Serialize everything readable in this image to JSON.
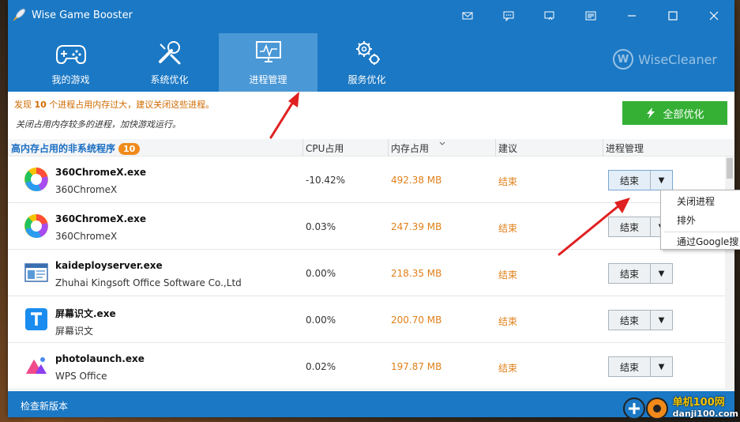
{
  "app": {
    "title": "Wise Game Booster"
  },
  "window_controls": [
    "mail-icon",
    "feedback-icon",
    "restore-icon",
    "menu-icon",
    "minimize-icon",
    "maximize-icon",
    "close-icon"
  ],
  "nav": {
    "tabs": [
      {
        "label": "我的游戏",
        "icon": "gamepad-icon",
        "active": false
      },
      {
        "label": "系统优化",
        "icon": "tools-icon",
        "active": false
      },
      {
        "label": "进程管理",
        "icon": "monitor-icon",
        "active": true
      },
      {
        "label": "服务优化",
        "icon": "gears-icon",
        "active": false
      }
    ]
  },
  "brand": {
    "name": "WiseCleaner",
    "letter": "W"
  },
  "notice": {
    "prefix": "发现 ",
    "count": "10",
    "suffix": " 个进程占用内存过大，建议关闭这些进程。",
    "sub": "关闭占用内存较多的进程，加快游戏运行。"
  },
  "optimize_button": "全部优化",
  "table": {
    "headers": {
      "name": "高内存占用的非系统程序",
      "badge": "10",
      "cpu": "CPU占用",
      "mem": "内存占用",
      "advice": "建议",
      "manage": "进程管理"
    },
    "rows": [
      {
        "name": "360ChromeX.exe",
        "desc": "360ChromeX",
        "cpu": "-10.42%",
        "mem": "492.38 MB",
        "advice": "结束",
        "action": "结束",
        "icon": "chrome-360-icon"
      },
      {
        "name": "360ChromeX.exe",
        "desc": "360ChromeX",
        "cpu": "0.03%",
        "mem": "247.39 MB",
        "advice": "结束",
        "action": "结束",
        "icon": "chrome-360-icon"
      },
      {
        "name": "kaideployserver.exe",
        "desc": "Zhuhai Kingsoft Office Software Co.,Ltd",
        "cpu": "0.00%",
        "mem": "218.35 MB",
        "advice": "结束",
        "action": "结束",
        "icon": "window-app-icon"
      },
      {
        "name": "屏幕识文.exe",
        "desc": "屏幕识文",
        "cpu": "0.00%",
        "mem": "200.70 MB",
        "advice": "结束",
        "action": "结束",
        "icon": "text-t-icon"
      },
      {
        "name": "photolaunch.exe",
        "desc": "WPS Office",
        "cpu": "0.02%",
        "mem": "197.87 MB",
        "advice": "结束",
        "action": "结束",
        "icon": "photo-app-icon"
      }
    ]
  },
  "context_menu": {
    "items": [
      "关闭进程",
      "排外",
      "通过Google搜"
    ]
  },
  "status": {
    "text": "检查新版本"
  },
  "watermark": {
    "line1": "单机100网",
    "line2": "danji100.com"
  },
  "colors": {
    "primary": "#1b78c4",
    "active_tab": "#4a98d6",
    "accent_green": "#35b035",
    "orange": "#e0801a",
    "arrow_red": "#e02020"
  }
}
